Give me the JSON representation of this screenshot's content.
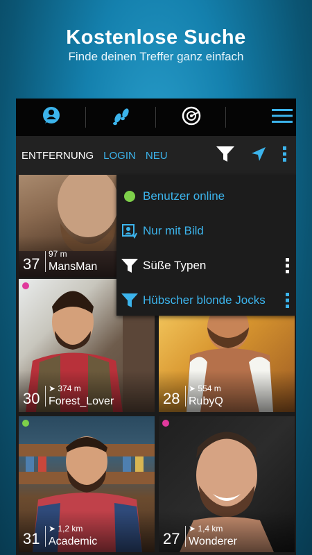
{
  "headline": "Kostenlose Suche",
  "subline": "Finde deinen Treffer ganz einfach",
  "topbar": {
    "icons": [
      "profile-icon",
      "footprints-icon",
      "radar-icon",
      "hamburger-menu-icon"
    ]
  },
  "filterbar": {
    "tabs": [
      "ENTFERNUNG",
      "LOGIN",
      "NEU"
    ],
    "icons": [
      "filter-icon",
      "location-arrow-icon",
      "more-vertical-icon"
    ]
  },
  "menu": {
    "items": [
      {
        "label": "Benutzer online",
        "icon": "green-dot-icon",
        "color": "#3cb4ec"
      },
      {
        "label": "Nur mit Bild",
        "icon": "photo-profile-icon",
        "color": "#3cb4ec"
      },
      {
        "label": "Süße Typen",
        "icon": "filter-icon",
        "color": "#ffffff"
      },
      {
        "label": "Hübscher blonde Jocks",
        "icon": "filter-icon",
        "color": "#3cb4ec"
      }
    ]
  },
  "profiles": [
    {
      "age": "37",
      "distance": "97 m",
      "name": "MansMan",
      "status": ""
    },
    {
      "age": "30",
      "distance": "374 m",
      "name": "Forest_Lover",
      "status": "#e0399c"
    },
    {
      "age": "28",
      "distance": "554 m",
      "name": "RubyQ",
      "status": ""
    },
    {
      "age": "31",
      "distance": "1,2 km",
      "name": "Academic",
      "status": "#7ed04a"
    },
    {
      "age": "27",
      "distance": "1,4 km",
      "name": "Wonderer",
      "status": "#e0399c"
    }
  ],
  "colors": {
    "accent": "#3cb4ec",
    "online": "#7ed04a",
    "recent": "#e0399c",
    "background_top": "#2a9fcc"
  }
}
